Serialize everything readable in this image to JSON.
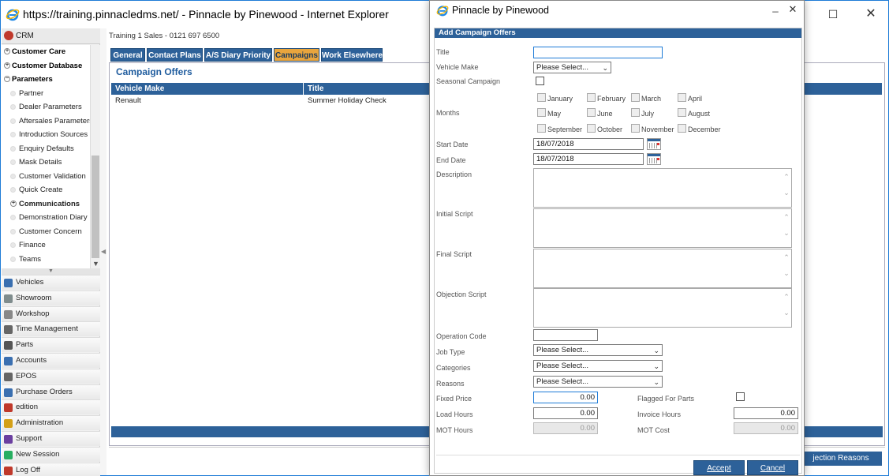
{
  "window": {
    "title": "https://training.pinnacledms.net/ - Pinnacle by Pinewood - Internet Explorer"
  },
  "sidebar": {
    "crm_label": "CRM",
    "tree": [
      {
        "label": "Customer Care",
        "level": 0
      },
      {
        "label": "Customer Database",
        "level": 0
      },
      {
        "label": "Parameters",
        "level": 0,
        "expanded": true
      },
      {
        "label": "Partner",
        "level": 1
      },
      {
        "label": "Dealer Parameters",
        "level": 1
      },
      {
        "label": "Aftersales Parameters",
        "level": 1
      },
      {
        "label": "Introduction Sources",
        "level": 1
      },
      {
        "label": "Enquiry Defaults",
        "level": 1
      },
      {
        "label": "Mask Details",
        "level": 1
      },
      {
        "label": "Customer Validation",
        "level": 1
      },
      {
        "label": "Quick Create",
        "level": 1
      },
      {
        "label": "Communications",
        "level": 1,
        "bold": true
      },
      {
        "label": "Demonstration Diary",
        "level": 1
      },
      {
        "label": "Customer Concern",
        "level": 1
      },
      {
        "label": "Finance",
        "level": 1
      },
      {
        "label": "Teams",
        "level": 1
      }
    ],
    "modules": [
      {
        "label": "Vehicles",
        "icon": "car-icon",
        "color": "#3a6fb0"
      },
      {
        "label": "Showroom",
        "icon": "showroom-icon",
        "color": "#7f8c8d"
      },
      {
        "label": "Workshop",
        "icon": "wrench-icon",
        "color": "#888888"
      },
      {
        "label": "Time Management",
        "icon": "clock-icon",
        "color": "#666666"
      },
      {
        "label": "Parts",
        "icon": "gear-icon",
        "color": "#555555"
      },
      {
        "label": "Accounts",
        "icon": "accounts-icon",
        "color": "#3a6fb0"
      },
      {
        "label": "EPOS",
        "icon": "epos-icon",
        "color": "#666666"
      },
      {
        "label": "Purchase Orders",
        "icon": "purchase-orders-icon",
        "color": "#3a6fb0"
      },
      {
        "label": "edition",
        "icon": "edition-icon",
        "color": "#c0392b"
      },
      {
        "label": "Administration",
        "icon": "lock-icon",
        "color": "#d4a017"
      },
      {
        "label": "Support",
        "icon": "support-icon",
        "color": "#6b3fa0"
      },
      {
        "label": "New Session",
        "icon": "new-session-icon",
        "color": "#27ae60"
      },
      {
        "label": "Log Off",
        "icon": "power-icon",
        "color": "#c0392b"
      }
    ]
  },
  "content": {
    "breadcrumb": "Training 1 Sales - 0121 697 6500",
    "tabs": [
      "General",
      "Contact Plans",
      "A/S Diary Priority",
      "Campaigns",
      "Work Elsewhere"
    ],
    "active_tab": "Campaigns",
    "panel_title": "Campaign Offers",
    "grid": {
      "columns": [
        "Vehicle Make",
        "Title"
      ],
      "rows": [
        [
          "Renault",
          "Summer Holiday Check"
        ]
      ]
    },
    "objection_button": "jection Reasons"
  },
  "dialog": {
    "title": "Pinnacle by Pinewood",
    "form_header": "Add Campaign Offers",
    "labels": {
      "title": "Title",
      "vehicle_make": "Vehicle Make",
      "seasonal_campaign": "Seasonal Campaign",
      "months": "Months",
      "start_date": "Start Date",
      "end_date": "End Date",
      "description": "Description",
      "initial_script": "Initial Script",
      "final_script": "Final Script",
      "objection_script": "Objection Script",
      "operation_code": "Operation Code",
      "job_type": "Job Type",
      "categories": "Categories",
      "reasons": "Reasons",
      "fixed_price": "Fixed Price",
      "flagged_for_parts": "Flagged For Parts",
      "load_hours": "Load Hours",
      "invoice_hours": "Invoice Hours",
      "mot_hours": "MOT Hours",
      "mot_cost": "MOT Cost"
    },
    "values": {
      "title": "",
      "vehicle_make": "Please Select...",
      "start_date": "18/07/2018",
      "end_date": "18/07/2018",
      "operation_code": "",
      "job_type": "Please Select...",
      "categories": "Please Select...",
      "reasons": "Please Select...",
      "fixed_price": "0.00",
      "load_hours": "0.00",
      "invoice_hours": "0.00",
      "mot_hours": "0.00",
      "mot_cost": "0.00"
    },
    "months": [
      "January",
      "February",
      "March",
      "April",
      "May",
      "June",
      "July",
      "August",
      "September",
      "October",
      "November",
      "December"
    ],
    "buttons": {
      "accept": "Accept",
      "cancel": "Cancel"
    }
  },
  "colors": {
    "header_blue": "#2d6199",
    "active_tab": "#e9a53d",
    "title_blue": "#1f5c9e"
  }
}
